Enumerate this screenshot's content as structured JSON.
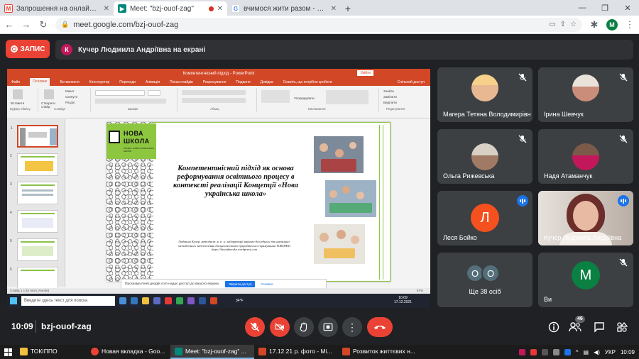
{
  "browser": {
    "tabs": [
      {
        "title": "Запрошення на онлайн-треніг",
        "icon": "gmail-icon",
        "active": false
      },
      {
        "title": "Meet: \"bzj-ouof-zag\"",
        "icon": "meet-icon",
        "active": true
      },
      {
        "title": "вчимося жити разом - Пошук G",
        "icon": "google-icon",
        "active": false
      }
    ],
    "url": "meet.google.com/bzj-ouof-zag",
    "profile_letter": "M"
  },
  "meet": {
    "record_label": "ЗАПИС",
    "presenter_initial": "К",
    "presenting_text": "Кучер Людмила Андріївна на екрані",
    "time": "10:09",
    "meeting_code": "bzj-ouof-zag",
    "people_count": "46"
  },
  "shared_screen": {
    "window_title": "Компетентнісний підхід - PowerPoint",
    "login_label": "Увійти",
    "ribbon_tabs": [
      "Файл",
      "Основне",
      "Вставлення",
      "Конструктор",
      "Переходи",
      "Анімація",
      "Показ слайдів",
      "Рецензування",
      "Подання",
      "Довідка",
      "Скажіть, що потрібно зробити"
    ],
    "share_label": "Спільний доступ",
    "ribbon_groups": [
      "Буфер обміну",
      "Слайди",
      "Шрифт",
      "Абзац",
      "Малювання",
      "Редагування"
    ],
    "ribbon_buttons": [
      "Вставити",
      "Створити слайд",
      "Макет",
      "Скинути",
      "Розділ",
      "Упорядкувати",
      "Знайти",
      "Замінити",
      "Виділити"
    ],
    "slide_numbers": [
      "1",
      "2",
      "3",
      "4",
      "5",
      "6"
    ],
    "slide_title": "Компетентнісний підхід як основа реформування освітнього процесу в контексті реалізації Концепції «Нова українська школа»",
    "slide_author": "Людмила Кучер, методист, к. п. н. лабораторії науково-дослідного та навчально-методичного забезпечення дисциплін етико-природничого спрямування ТОКІППО https://ktoitabnevka.wordpress.com",
    "logo_line1": "НОВА",
    "logo_line2": "ШКОЛА",
    "logo_sub": "ПРОЕКТ НОВОЇ УКРАЇНСЬКОЇ ШКОЛИ",
    "share_notice": "Програма meet.google.com надає доступ до вашого екрана.",
    "stop_sharing": "Закрити доступ",
    "hide_label": "Сховати",
    "status_left": "Слайд 1 з 33   Англ (Англія)",
    "zoom": "67%",
    "taskbar_search": "Введите здесь текст для поиска",
    "weather": "34°F",
    "clock_time": "10:09",
    "clock_date": "17.12.2021"
  },
  "participants": [
    {
      "name": "Магера Тетяна Володимирівна",
      "type": "photo",
      "muted": true
    },
    {
      "name": "Ірина Шевчук",
      "type": "photo",
      "muted": true
    },
    {
      "name": "Ольга Рижевська",
      "type": "photo",
      "muted": true
    },
    {
      "name": "Надя Атаманчук",
      "type": "photo",
      "muted": true
    },
    {
      "name": "Леся Бойко",
      "type": "letter",
      "letter": "Л",
      "color": "#f4511e",
      "speaking": true
    },
    {
      "name": "Кучер Людмила Андріївна",
      "type": "video",
      "speaking": true
    },
    {
      "more_label": "Ще 38 осіб",
      "letters": [
        "О",
        "О"
      ],
      "color": "#546e7a"
    },
    {
      "name": "Ви",
      "type": "letter",
      "letter": "M",
      "color": "#0b8043",
      "muted": true
    }
  ],
  "taskbar": {
    "items": [
      "ТОКІППО",
      "Новая вкладка - Goo...",
      "Meet: \"bzj-ouof-zag\" ...",
      "17.12.21 р. фото - Mi...",
      "Розвиток життєвих н..."
    ],
    "lang": "УКР",
    "time": "10:09"
  },
  "colors": {
    "meet_bg": "#202124",
    "tile_bg": "#3c4043",
    "accent_red": "#ea4335",
    "accent_blue": "#1a73e8",
    "ppt_orange": "#d24726",
    "nus_green": "#8dc63f"
  }
}
